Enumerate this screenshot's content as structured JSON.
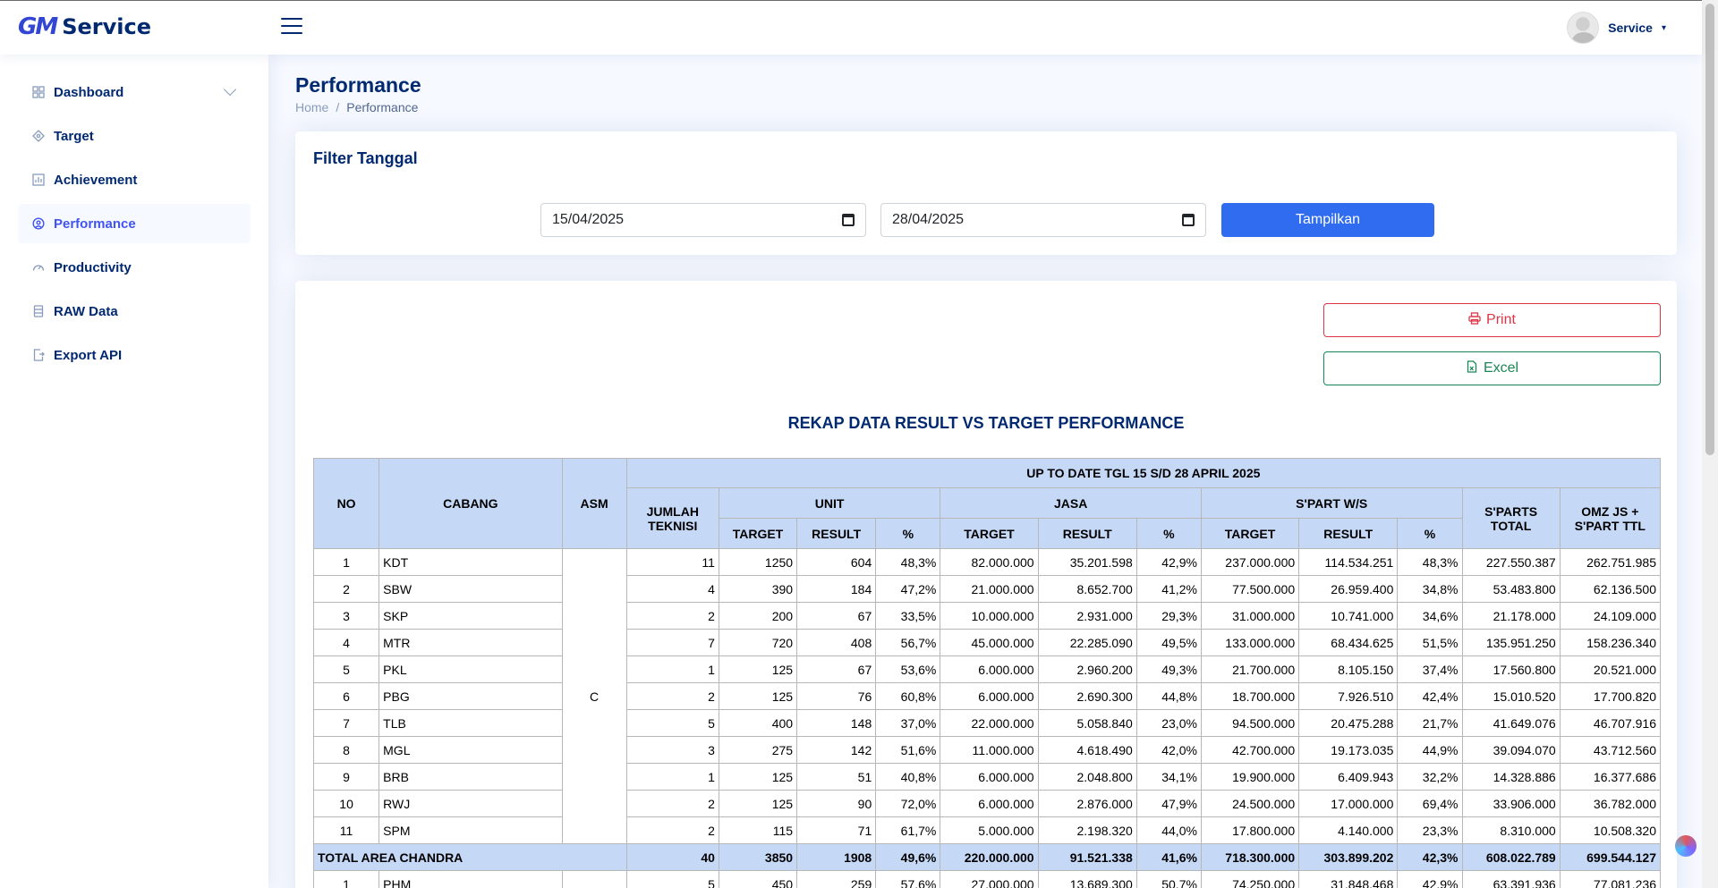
{
  "brand": {
    "mark": "GM",
    "name": "Service"
  },
  "header": {
    "profile_name": "Service"
  },
  "sidebar": {
    "items": [
      {
        "label": "Dashboard",
        "icon": "grid-icon"
      },
      {
        "label": "Target",
        "icon": "target-icon"
      },
      {
        "label": "Achievement",
        "icon": "chart-icon"
      },
      {
        "label": "Performance",
        "icon": "gauge-icon"
      },
      {
        "label": "Productivity",
        "icon": "speedometer-icon"
      },
      {
        "label": "RAW Data",
        "icon": "database-icon"
      },
      {
        "label": "Export API",
        "icon": "file-export-icon"
      }
    ]
  },
  "page": {
    "title": "Performance",
    "breadcrumb": [
      "Home",
      "/",
      "Performance"
    ]
  },
  "filter": {
    "title": "Filter Tanggal",
    "start_date": "15/04/2025",
    "end_date": "28/04/2025",
    "button": "Tampilkan"
  },
  "actions": {
    "print": "Print",
    "excel": "Excel"
  },
  "report": {
    "title": "REKAP DATA RESULT VS TARGET PERFORMANCE",
    "headers": {
      "no": "NO",
      "cabang": "CABANG",
      "asm": "ASM",
      "period": "UP TO DATE TGL 15 S/D 28 APRIL 2025",
      "jumlah_teknisi": "JUMLAH TEKNISI",
      "unit": "UNIT",
      "jasa": "JASA",
      "spart_ws": "S'PART W/S",
      "sparts_total": "S'PARTS TOTAL",
      "omz": "OMZ JS + S'PART TTL",
      "target": "TARGET",
      "result": "RESULT",
      "pct": "%"
    },
    "asm_value": "C",
    "rows": [
      [
        "1",
        "KDT",
        "11",
        "1250",
        "604",
        "48,3%",
        "82.000.000",
        "35.201.598",
        "42,9%",
        "237.000.000",
        "114.534.251",
        "48,3%",
        "227.550.387",
        "262.751.985"
      ],
      [
        "2",
        "SBW",
        "4",
        "390",
        "184",
        "47,2%",
        "21.000.000",
        "8.652.700",
        "41,2%",
        "77.500.000",
        "26.959.400",
        "34,8%",
        "53.483.800",
        "62.136.500"
      ],
      [
        "3",
        "SKP",
        "2",
        "200",
        "67",
        "33,5%",
        "10.000.000",
        "2.931.000",
        "29,3%",
        "31.000.000",
        "10.741.000",
        "34,6%",
        "21.178.000",
        "24.109.000"
      ],
      [
        "4",
        "MTR",
        "7",
        "720",
        "408",
        "56,7%",
        "45.000.000",
        "22.285.090",
        "49,5%",
        "133.000.000",
        "68.434.625",
        "51,5%",
        "135.951.250",
        "158.236.340"
      ],
      [
        "5",
        "PKL",
        "1",
        "125",
        "67",
        "53,6%",
        "6.000.000",
        "2.960.200",
        "49,3%",
        "21.700.000",
        "8.105.150",
        "37,4%",
        "17.560.800",
        "20.521.000"
      ],
      [
        "6",
        "PBG",
        "2",
        "125",
        "76",
        "60,8%",
        "6.000.000",
        "2.690.300",
        "44,8%",
        "18.700.000",
        "7.926.510",
        "42,4%",
        "15.010.520",
        "17.700.820"
      ],
      [
        "7",
        "TLB",
        "5",
        "400",
        "148",
        "37,0%",
        "22.000.000",
        "5.058.840",
        "23,0%",
        "94.500.000",
        "20.475.288",
        "21,7%",
        "41.649.076",
        "46.707.916"
      ],
      [
        "8",
        "MGL",
        "3",
        "275",
        "142",
        "51,6%",
        "11.000.000",
        "4.618.490",
        "42,0%",
        "42.700.000",
        "19.173.035",
        "44,9%",
        "39.094.070",
        "43.712.560"
      ],
      [
        "9",
        "BRB",
        "1",
        "125",
        "51",
        "40,8%",
        "6.000.000",
        "2.048.800",
        "34,1%",
        "19.900.000",
        "6.409.943",
        "32,2%",
        "14.328.886",
        "16.377.686"
      ],
      [
        "10",
        "RWJ",
        "2",
        "125",
        "90",
        "72,0%",
        "6.000.000",
        "2.876.000",
        "47,9%",
        "24.500.000",
        "17.000.000",
        "69,4%",
        "33.906.000",
        "36.782.000"
      ],
      [
        "11",
        "SPM",
        "2",
        "115",
        "71",
        "61,7%",
        "5.000.000",
        "2.198.320",
        "44,0%",
        "17.800.000",
        "4.140.000",
        "23,3%",
        "8.310.000",
        "10.508.320"
      ]
    ],
    "total": [
      "TOTAL AREA CHANDRA",
      "40",
      "3850",
      "1908",
      "49,6%",
      "220.000.000",
      "91.521.338",
      "41,6%",
      "718.300.000",
      "303.899.202",
      "42,3%",
      "608.022.789",
      "699.544.127"
    ],
    "next_row": [
      "1",
      "PHM",
      "5",
      "450",
      "259",
      "57,6%",
      "27.000.000",
      "13.689.300",
      "50,7%",
      "74.250.000",
      "31.848.468",
      "42,9%",
      "63.391.936",
      "77.081.236"
    ]
  }
}
